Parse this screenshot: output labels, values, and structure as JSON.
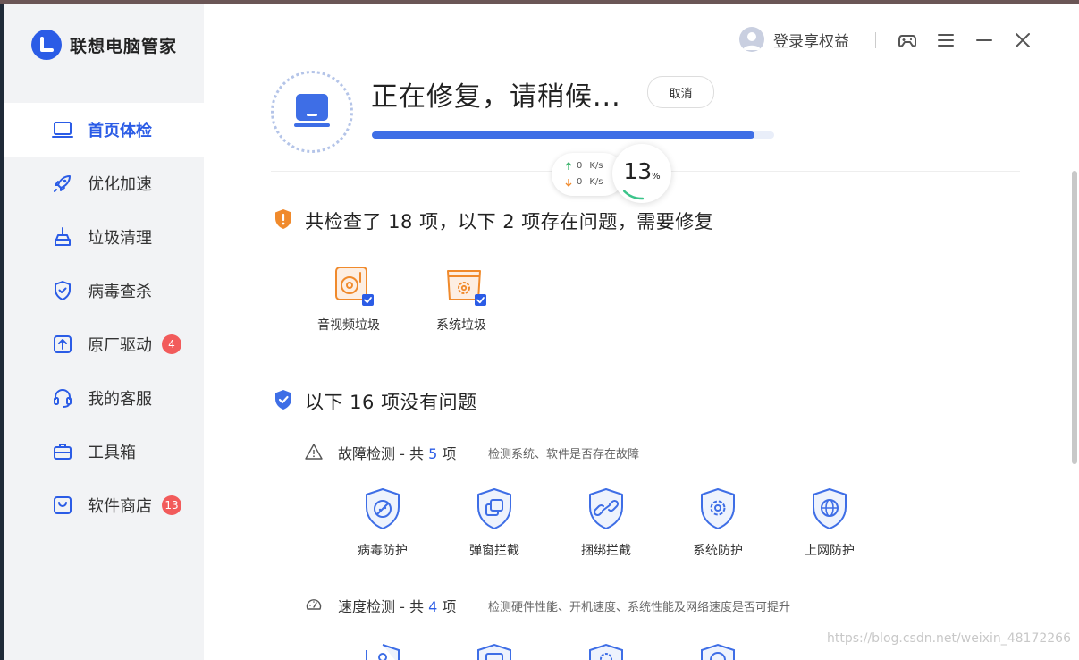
{
  "app": {
    "name": "联想电脑管家"
  },
  "sidebar": {
    "items": [
      {
        "label": "首页体检",
        "icon": "laptop-icon",
        "active": true
      },
      {
        "label": "优化加速",
        "icon": "rocket-icon"
      },
      {
        "label": "垃圾清理",
        "icon": "broom-icon"
      },
      {
        "label": "病毒查杀",
        "icon": "shield-check-icon"
      },
      {
        "label": "原厂驱动",
        "icon": "upload-icon",
        "badge": "4"
      },
      {
        "label": "我的客服",
        "icon": "headset-icon"
      },
      {
        "label": "工具箱",
        "icon": "toolbox-icon"
      },
      {
        "label": "软件商店",
        "icon": "store-icon",
        "badge": "13"
      }
    ]
  },
  "topbar": {
    "login_label": "登录享权益"
  },
  "status": {
    "title": "正在修复，请稍候...",
    "cancel_label": "取消",
    "progress_fraction": 0.95,
    "percent": "13",
    "percent_unit": "%",
    "upload_speed": "0",
    "download_speed": "0",
    "speed_unit": "K/s"
  },
  "issues": {
    "title": "共检查了 18 项，以下 2 项存在问题，需要修复",
    "items": [
      {
        "label": "音视频垃圾",
        "icon": "media-disc-icon",
        "checked": true
      },
      {
        "label": "系统垃圾",
        "icon": "system-box-icon",
        "checked": true
      }
    ]
  },
  "ok": {
    "title": "以下 16 项没有问题",
    "groups": [
      {
        "name": "故障检测",
        "sep": " - 共 ",
        "count": "5",
        "unit": " 项",
        "desc": "检测系统、软件是否存在故障",
        "items": [
          {
            "label": "病毒防护",
            "icon": "virus-shield-icon"
          },
          {
            "label": "弹窗拦截",
            "icon": "popup-shield-icon"
          },
          {
            "label": "捆绑拦截",
            "icon": "link-shield-icon"
          },
          {
            "label": "系统防护",
            "icon": "gear-shield-icon"
          },
          {
            "label": "上网防护",
            "icon": "globe-shield-icon"
          }
        ]
      },
      {
        "name": "速度检测",
        "sep": " - 共 ",
        "count": "4",
        "unit": " 项",
        "desc": "检测硬件性能、开机速度、系统性能及网络速度是否可提升"
      }
    ]
  },
  "watermark": "https://blog.csdn.net/weixin_48172266",
  "colors": {
    "accent": "#2b5ce6",
    "warning": "#f08a2c",
    "badge": "#f25b5b"
  }
}
